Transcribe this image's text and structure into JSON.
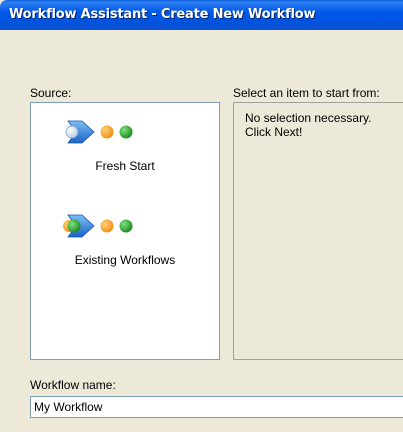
{
  "window": {
    "title": "Workflow Assistant - Create New Workflow"
  },
  "source": {
    "label": "Source:",
    "items": [
      {
        "label": "Fresh Start",
        "icon": "fresh-start-icon"
      },
      {
        "label": "Existing Workflows",
        "icon": "existing-workflows-icon"
      }
    ]
  },
  "start_from": {
    "label": "Select an item to start from:",
    "message": "No selection necessary.\nClick Next!"
  },
  "workflow_name": {
    "label": "Workflow name:",
    "value": "My Workflow"
  },
  "colors": {
    "title_bar": "#0058e6",
    "window_bg": "#ece9d8",
    "list_border": "#7f9db9",
    "arrow_blue": "#2c7fd6",
    "dot_orange": "#f5a623",
    "dot_green": "#2fa83a"
  }
}
